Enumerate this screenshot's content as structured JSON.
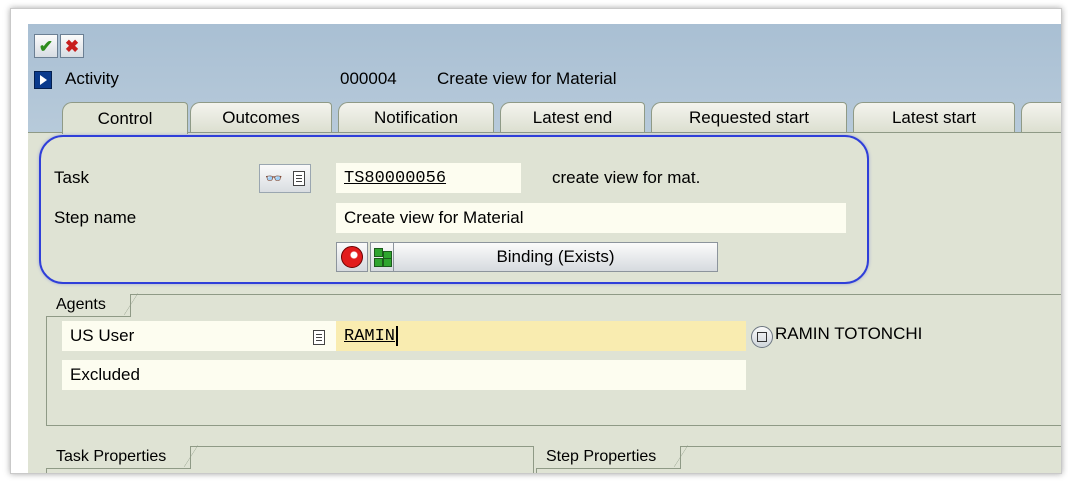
{
  "toolbar": {
    "ok_icon": "check-icon",
    "cancel_icon": "cross-icon"
  },
  "header": {
    "activity_label": "Activity",
    "activity_number": "000004",
    "activity_description": "Create view for Material"
  },
  "tabs": [
    {
      "label": "Control",
      "active": true
    },
    {
      "label": "Outcomes",
      "active": false
    },
    {
      "label": "Notification",
      "active": false
    },
    {
      "label": "Latest end",
      "active": false
    },
    {
      "label": "Requested start",
      "active": false
    },
    {
      "label": "Latest start",
      "active": false
    }
  ],
  "task": {
    "label": "Task",
    "id": "TS80000056",
    "description": "create view for mat."
  },
  "step": {
    "label": "Step name",
    "value": "Create view for Material"
  },
  "binding": {
    "label": "Binding (Exists)"
  },
  "agents": {
    "title": "Agents",
    "us_user_label": "US User",
    "us_user_value": "RAMIN",
    "us_user_name": "RAMIN TOTONCHI",
    "excluded_label": "Excluded",
    "excluded_value": ""
  },
  "bottom_groups": {
    "task_properties": "Task Properties",
    "step_properties": "Step Properties"
  },
  "colors": {
    "highlight": "#2f3fd9",
    "input_active": "#f9ecb0",
    "input": "#fdfdf0",
    "background": "#dfe3d4"
  }
}
